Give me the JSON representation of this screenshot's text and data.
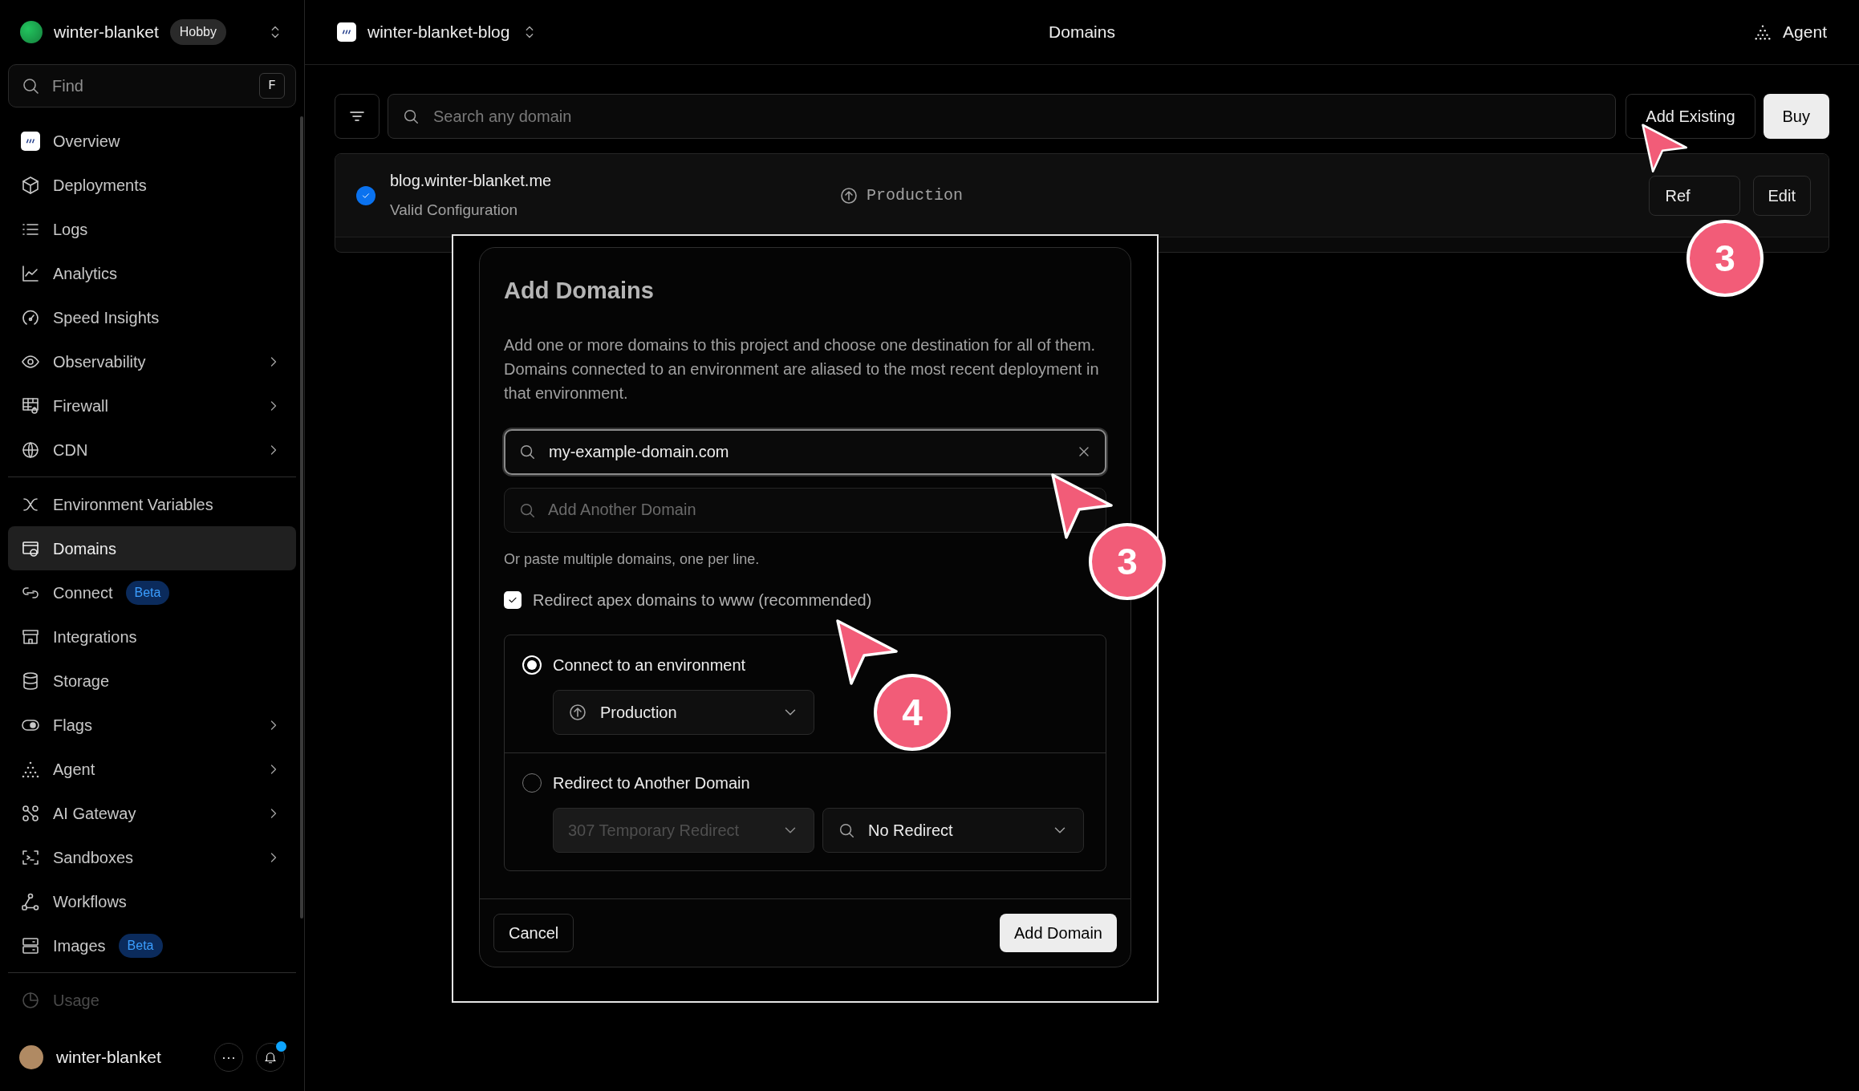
{
  "team": {
    "name": "winter-blanket",
    "plan": "Hobby"
  },
  "find": {
    "placeholder": "Find",
    "shortcut": "F"
  },
  "sidebar": {
    "sections": [
      [
        {
          "label": "Overview",
          "selected": false,
          "submenu": false,
          "disabled": false
        },
        {
          "label": "Deployments",
          "selected": false,
          "submenu": false,
          "disabled": false
        },
        {
          "label": "Logs",
          "selected": false,
          "submenu": false,
          "disabled": false
        },
        {
          "label": "Analytics",
          "selected": false,
          "submenu": false,
          "disabled": false
        },
        {
          "label": "Speed Insights",
          "selected": false,
          "submenu": false,
          "disabled": false
        },
        {
          "label": "Observability",
          "selected": false,
          "submenu": true,
          "disabled": false
        },
        {
          "label": "Firewall",
          "selected": false,
          "submenu": true,
          "disabled": false
        },
        {
          "label": "CDN",
          "selected": false,
          "submenu": true,
          "disabled": false
        }
      ],
      [
        {
          "label": "Environment Variables",
          "selected": false,
          "submenu": false,
          "disabled": false
        },
        {
          "label": "Domains",
          "selected": true,
          "submenu": false,
          "disabled": false
        },
        {
          "label": "Connect",
          "selected": false,
          "submenu": false,
          "disabled": false,
          "badge": "Beta"
        },
        {
          "label": "Integrations",
          "selected": false,
          "submenu": false,
          "disabled": false
        },
        {
          "label": "Storage",
          "selected": false,
          "submenu": false,
          "disabled": false
        },
        {
          "label": "Flags",
          "selected": false,
          "submenu": true,
          "disabled": false
        },
        {
          "label": "Agent",
          "selected": false,
          "submenu": true,
          "disabled": false
        },
        {
          "label": "AI Gateway",
          "selected": false,
          "submenu": true,
          "disabled": false
        },
        {
          "label": "Sandboxes",
          "selected": false,
          "submenu": true,
          "disabled": false
        },
        {
          "label": "Workflows",
          "selected": false,
          "submenu": false,
          "disabled": false
        },
        {
          "label": "Images",
          "selected": false,
          "submenu": false,
          "disabled": false,
          "badge": "Beta"
        }
      ],
      [
        {
          "label": "Usage",
          "selected": false,
          "submenu": false,
          "disabled": true
        }
      ]
    ],
    "user": {
      "name": "winter-blanket",
      "more": "···",
      "notification": true
    }
  },
  "header": {
    "project": "winter-blanket-blog",
    "title": "Domains",
    "agent": "Agent"
  },
  "toolbar": {
    "search_placeholder": "Search any domain",
    "buttons": [
      "Add Existing",
      "Buy"
    ]
  },
  "domains": [
    {
      "name": "blog.winter-blanket.me",
      "status": "Valid Configuration",
      "verified": true,
      "environment": "Production",
      "buttons": [
        "Ref",
        "Edit"
      ]
    }
  ],
  "dialog": {
    "title": "Add Domains",
    "description": "Add one or more domains to this project and choose one destination for all of them. Domains connected to an environment are aliased to the most recent deployment in that environment.",
    "domain_input": {
      "value": "my-example-domain.com"
    },
    "another_input": {
      "placeholder": "Add Another Domain"
    },
    "hint": "Or paste multiple domains, one per line.",
    "redirect_checkbox": {
      "label": "Redirect apex domains to www (recommended)",
      "checked": true
    },
    "options": [
      {
        "kind": "environment",
        "label": "Connect to an environment",
        "selected": true,
        "select": {
          "label": "Production",
          "disabled": false
        }
      },
      {
        "kind": "redirect",
        "label": "Redirect to Another Domain",
        "selected": false,
        "status_select": {
          "label": "307 Temporary Redirect",
          "disabled": true
        },
        "target_select": {
          "label": "No Redirect",
          "disabled": false
        }
      }
    ],
    "cancel": "Cancel",
    "submit": "Add Domain"
  },
  "callouts": [
    {
      "number": "3"
    },
    {
      "number": "3"
    },
    {
      "number": "4"
    }
  ]
}
